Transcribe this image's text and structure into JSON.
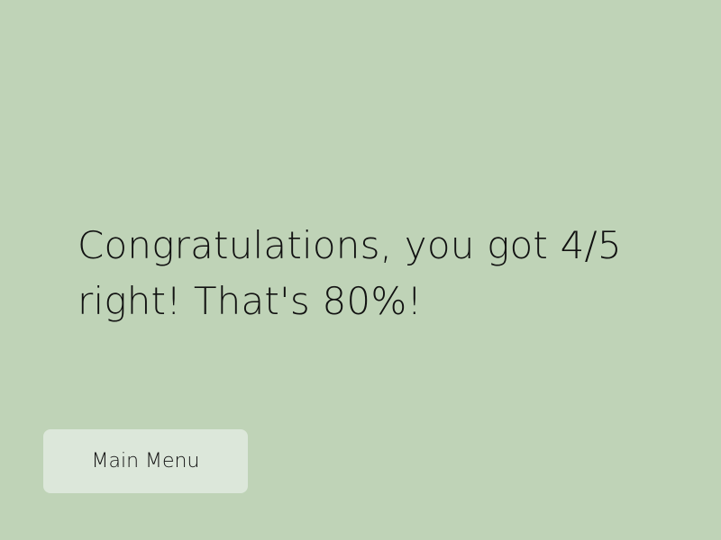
{
  "colors": {
    "background": "#bfd3b7",
    "button_background": "#dce7da",
    "text": "#111111"
  },
  "result": {
    "message": "Congratulations, you got 4/5 right! That's 80%!"
  },
  "actions": {
    "main_menu_label": "Main Menu"
  }
}
